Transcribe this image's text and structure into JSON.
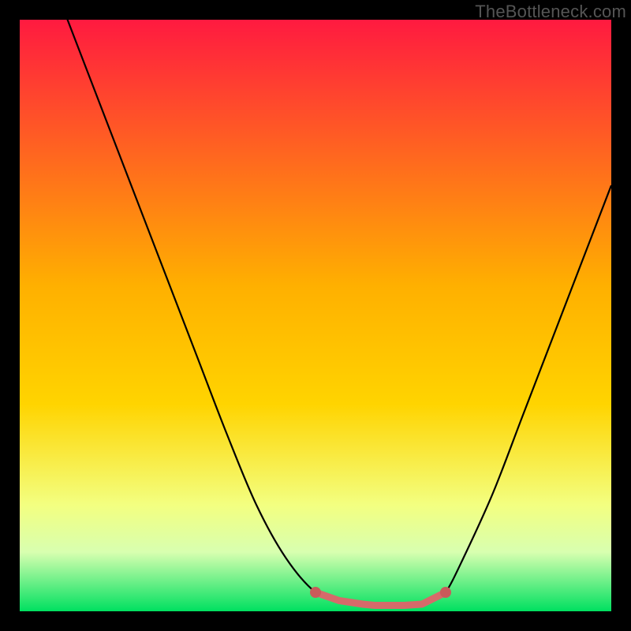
{
  "watermark": "TheBottleneck.com",
  "colors": {
    "frame_bg": "#000000",
    "gradient_top": "#ff1a40",
    "gradient_mid": "#ffd400",
    "gradient_low": "#f7ffb0",
    "gradient_bottom": "#00e060",
    "curve_stroke": "#000000",
    "trough_line": "#d66a6a",
    "trough_dot": "#c95a5a",
    "watermark_text": "#555555"
  },
  "chart_data": {
    "type": "line",
    "title": "",
    "xlabel": "",
    "ylabel": "",
    "xlim": [
      0,
      100
    ],
    "ylim": [
      0,
      100
    ],
    "x": [
      0,
      5,
      10,
      15,
      20,
      25,
      30,
      35,
      40,
      45,
      50,
      54,
      58,
      60,
      62,
      65,
      68,
      70,
      72,
      75,
      80,
      85,
      90,
      95,
      100
    ],
    "series": [
      {
        "name": "bottleneck-curve",
        "values": [
          null,
          108,
          95,
          82,
          69,
          56,
          43,
          30,
          18,
          9,
          3.2,
          1.8,
          1.2,
          1.0,
          1.0,
          1.0,
          1.2,
          1.8,
          3.2,
          9,
          20,
          33,
          46,
          59,
          72
        ]
      }
    ],
    "annotations": {
      "trough_range_x": [
        50,
        72
      ],
      "trough_y": 1.5,
      "trough_dots_x": [
        50,
        54,
        58,
        60,
        62,
        65,
        68,
        72
      ]
    }
  }
}
